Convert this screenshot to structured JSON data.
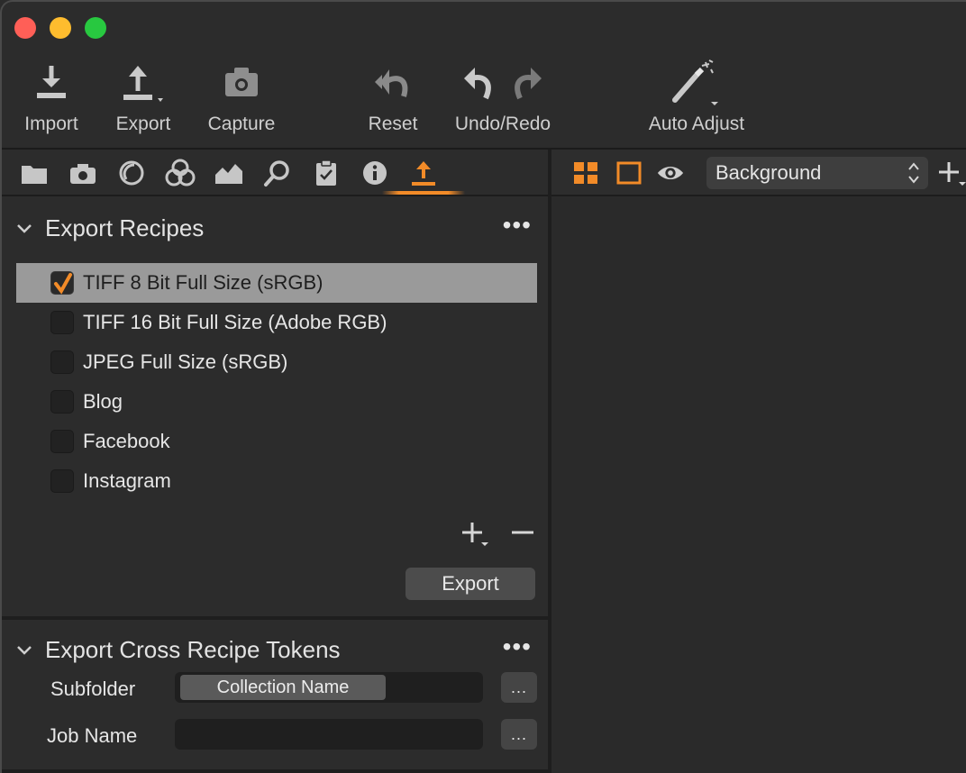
{
  "toolbar": {
    "import_label": "Import",
    "export_label": "Export",
    "capture_label": "Capture",
    "reset_label": "Reset",
    "undo_redo_label": "Undo/Redo",
    "auto_adjust_label": "Auto Adjust"
  },
  "tool_tabs": [
    {
      "icon": "folder-icon"
    },
    {
      "icon": "camera-icon"
    },
    {
      "icon": "lens-icon"
    },
    {
      "icon": "color-icon"
    },
    {
      "icon": "exposure-icon"
    },
    {
      "icon": "details-icon"
    },
    {
      "icon": "adjustments-clipboard-icon"
    },
    {
      "icon": "metadata-icon"
    },
    {
      "icon": "export-icon",
      "active": true
    }
  ],
  "export_recipes": {
    "title": "Export Recipes",
    "more": "•••",
    "items": [
      {
        "label": "TIFF 8 Bit Full Size (sRGB)",
        "checked": true,
        "selected": true
      },
      {
        "label": "TIFF 16 Bit Full Size (Adobe RGB)",
        "checked": false
      },
      {
        "label": "JPEG Full Size (sRGB)",
        "checked": false
      },
      {
        "label": "Blog",
        "checked": false
      },
      {
        "label": "Facebook",
        "checked": false
      },
      {
        "label": "Instagram",
        "checked": false
      }
    ],
    "export_button": "Export"
  },
  "tokens": {
    "title": "Export Cross Recipe Tokens",
    "more": "•••",
    "subfolder_label": "Subfolder",
    "subfolder_token": "Collection Name",
    "job_name_label": "Job Name",
    "ellipsis": "..."
  },
  "viewer": {
    "layer_select": "Background"
  },
  "colors": {
    "accent": "#f28b28",
    "background": "#2c2c2c",
    "selected_row": "#9a9a9a"
  }
}
